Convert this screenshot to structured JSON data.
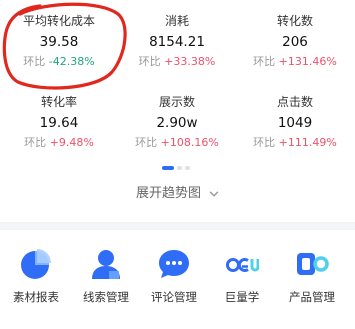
{
  "stats": [
    {
      "label": "平均转化成本",
      "value": "39.58",
      "change_prefix": "环比",
      "change": "-42.38%",
      "direction": "down"
    },
    {
      "label": "消耗",
      "value": "8154.21",
      "change_prefix": "环比",
      "change": "+33.38%",
      "direction": "up"
    },
    {
      "label": "转化数",
      "value": "206",
      "change_prefix": "环比",
      "change": "+131.46%",
      "direction": "up"
    },
    {
      "label": "转化率",
      "value": "19.64",
      "change_prefix": "环比",
      "change": "+9.48%",
      "direction": "up"
    },
    {
      "label": "展示数",
      "value": "2.90w",
      "change_prefix": "环比",
      "change": "+108.16%",
      "direction": "up"
    },
    {
      "label": "点击数",
      "value": "1049",
      "change_prefix": "环比",
      "change": "+111.49%",
      "direction": "up"
    }
  ],
  "expand_label": "展开趋势图",
  "tools": [
    {
      "label": "素材报表",
      "icon": "pie-chart-icon"
    },
    {
      "label": "线索管理",
      "icon": "user-icon"
    },
    {
      "label": "评论管理",
      "icon": "chat-bubble-icon"
    },
    {
      "label": "巨量学",
      "icon": "ocean-logo-icon"
    },
    {
      "label": "产品管理",
      "icon": "product-logo-icon"
    }
  ],
  "colors": {
    "accent_blue": "#2f6df6",
    "up_red": "#f0506a",
    "down_green": "#1fa97c",
    "annotation_red": "#e0281e"
  }
}
